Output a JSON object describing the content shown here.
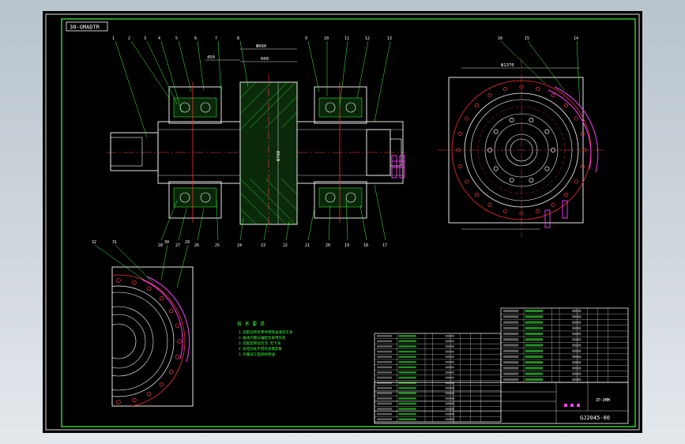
{
  "drawing": {
    "title_tag": "30-GMADTR",
    "drawing_number": "GJ2045-00",
    "title_block_label": "ZP-DMM",
    "main_dims": [
      "450",
      "Ф660",
      "600",
      "Ф760",
      "Ф1370"
    ],
    "callouts_top": [
      "1",
      "2",
      "3",
      "4",
      "5",
      "6",
      "7",
      "8",
      "9",
      "10",
      "11",
      "12",
      "13"
    ],
    "callouts_bottom": [
      "28",
      "27",
      "26",
      "25",
      "24",
      "23",
      "22",
      "21",
      "20",
      "19",
      "18",
      "17"
    ],
    "callouts_right": [
      "16",
      "15",
      "14"
    ],
    "detail_callouts": [
      "32",
      "31",
      "30",
      "29"
    ]
  },
  "notes": {
    "heading": "技 术 要 求",
    "lines": [
      "1.装配前所有零件用煤油清洗干净",
      "2.轴承内圈与轴配合采用热装",
      "3.装配后转动灵活 无卡滞",
      "4.各密封处不得有渗漏现象",
      "5.外露加工面涂防锈油"
    ]
  },
  "bom": {
    "rows": 17,
    "cols": 10
  }
}
